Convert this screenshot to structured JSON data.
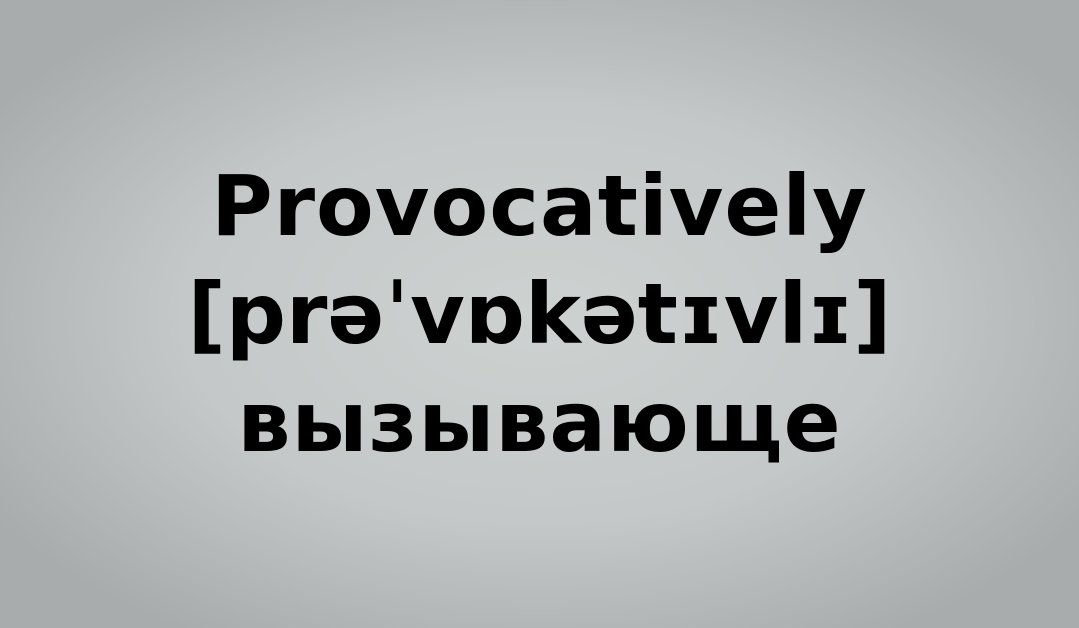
{
  "card": {
    "word": "Provocatively",
    "transcription": "[prəˈvɒkətɪvlɪ]",
    "translation": "вызывающе"
  }
}
